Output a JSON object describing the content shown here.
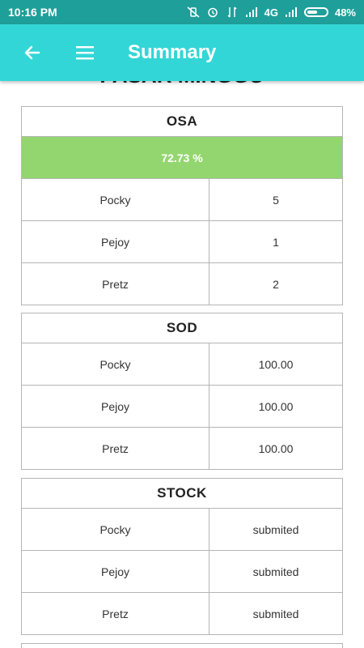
{
  "status": {
    "time": "10:16 PM",
    "network": "4G",
    "battery": "48%"
  },
  "appbar": {
    "title": "Summary",
    "back_icon": "arrow-back-icon",
    "menu_icon": "hamburger-menu-icon"
  },
  "heading": "PASAR MINGGU",
  "osa": {
    "title": "OSA",
    "percent": "72.73 %",
    "percent_color": "#93d66f",
    "rows": [
      {
        "name": "Pocky",
        "value": "5"
      },
      {
        "name": "Pejoy",
        "value": "1"
      },
      {
        "name": "Pretz",
        "value": "2"
      }
    ]
  },
  "sod": {
    "title": "SOD",
    "rows": [
      {
        "name": "Pocky",
        "value": "100.00"
      },
      {
        "name": "Pejoy",
        "value": "100.00"
      },
      {
        "name": "Pretz",
        "value": "100.00"
      }
    ]
  },
  "stock": {
    "title": "STOCK",
    "rows": [
      {
        "name": "Pocky",
        "value": "submited"
      },
      {
        "name": "Pejoy",
        "value": "submited"
      },
      {
        "name": "Pretz",
        "value": "submited"
      }
    ]
  },
  "colors": {
    "statusbar": "#1f9f9a",
    "appbar": "#33d6d6"
  }
}
